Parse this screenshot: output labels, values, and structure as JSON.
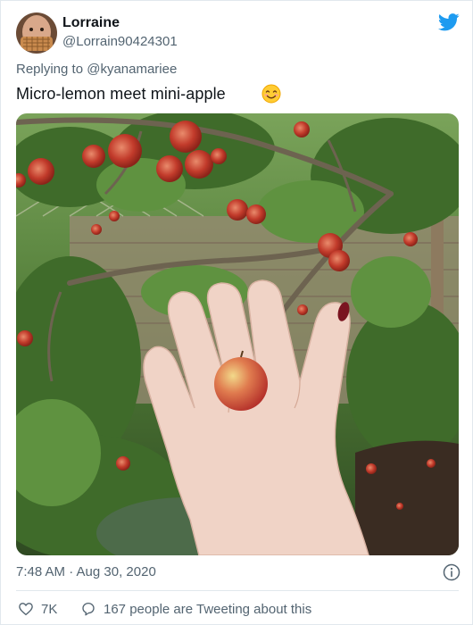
{
  "tweet": {
    "display_name": "Lorraine",
    "handle": "@Lorrain90424301",
    "reply_prefix": "Replying to",
    "reply_to": "@kyanamariee",
    "text": "Micro-lemon meet mini-apple",
    "emoji": "smiling-face-emoji",
    "timestamp": "7:48 AM · Aug 30, 2020",
    "likes": "7K",
    "tweeting_about": "167 people are Tweeting about this"
  },
  "icons": {
    "brand": "twitter-bird-icon",
    "info": "info-icon",
    "like": "heart-icon",
    "reply": "speech-bubble-icon"
  },
  "colors": {
    "twitter_blue": "#1d9bf0",
    "secondary_text": "#536471",
    "border": "#e1e8ed"
  }
}
